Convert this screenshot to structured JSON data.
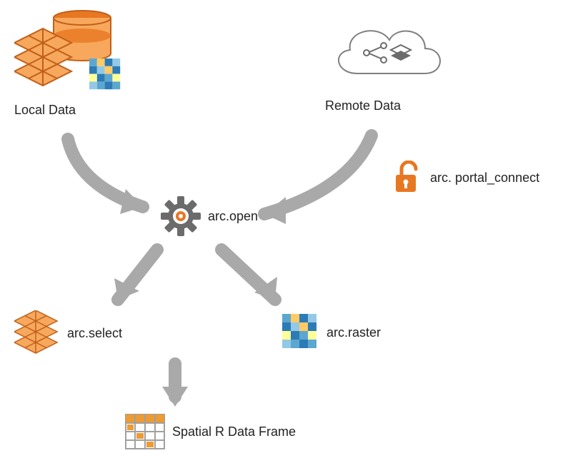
{
  "nodes": {
    "local_data": {
      "label": "Local Data"
    },
    "remote_data": {
      "label": "Remote Data"
    },
    "arc_open": {
      "label": "arc.open"
    },
    "portal_connect": {
      "label": "arc. portal_connect"
    },
    "arc_select": {
      "label": "arc.select"
    },
    "arc_raster": {
      "label": "arc.raster"
    },
    "spatial_frame": {
      "label": "Spatial R Data Frame"
    }
  },
  "colors": {
    "arrow": "#A9A9A9",
    "orange": "#E87722",
    "orange_dark": "#C15F18",
    "orange_light": "#F7A85C",
    "gear_gray": "#6B6B6B",
    "cloud": "#808080",
    "raster_blues": [
      "#2C7BB6",
      "#5CA7CF",
      "#93C9E6",
      "#FFFF99",
      "#FFCB66"
    ],
    "grid_orange": "#ED9B33",
    "grid_border": "#A0A0A0"
  }
}
